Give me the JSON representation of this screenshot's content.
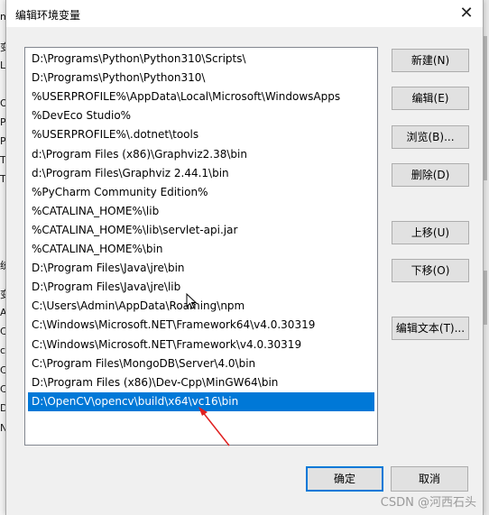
{
  "dialog": {
    "title": "编辑环境变量",
    "close_glyph": "✕"
  },
  "list": {
    "items": [
      "D:\\Programs\\Python\\Python310\\Scripts\\",
      "D:\\Programs\\Python\\Python310\\",
      "%USERPROFILE%\\AppData\\Local\\Microsoft\\WindowsApps",
      "%DevEco Studio%",
      "%USERPROFILE%\\.dotnet\\tools",
      "d:\\Program Files (x86)\\Graphviz2.38\\bin",
      "d:\\Program Files\\Graphviz 2.44.1\\bin",
      "%PyCharm Community Edition%",
      "%CATALINA_HOME%\\lib",
      "%CATALINA_HOME%\\lib\\servlet-api.jar",
      "%CATALINA_HOME%\\bin",
      "D:\\Program Files\\Java\\jre\\bin",
      "D:\\Program Files\\Java\\jre\\lib",
      "C:\\Users\\Admin\\AppData\\Roaming\\npm",
      "C:\\Windows\\Microsoft.NET\\Framework64\\v4.0.30319",
      "C:\\Windows\\Microsoft.NET\\Framework\\v4.0.30319",
      "C:\\Program Files\\MongoDB\\Server\\4.0\\bin",
      "D:\\Program Files (x86)\\Dev-Cpp\\MinGW64\\bin",
      "D:\\OpenCV\\opencv\\build\\x64\\vc16\\bin"
    ],
    "selected_index": 18
  },
  "buttons": {
    "new": "新建(N)",
    "edit": "编辑(E)",
    "browse": "浏览(B)...",
    "delete": "删除(D)",
    "move_up": "上移(U)",
    "move_down": "下移(O)",
    "edit_text": "编辑文本(T)...",
    "ok": "确定",
    "cancel": "取消"
  },
  "watermark": "CSDN @河西石头",
  "colors": {
    "selection": "#0078d7",
    "annotation_arrow": "#e02020"
  },
  "background": {
    "left_fragments": [
      "m",
      "变",
      "LA",
      "O",
      "Pa",
      "Py",
      "TE",
      "TM",
      "统",
      "变",
      "AD",
      "CA",
      "cla",
      "Co",
      "CU",
      "Dr",
      "N"
    ]
  }
}
